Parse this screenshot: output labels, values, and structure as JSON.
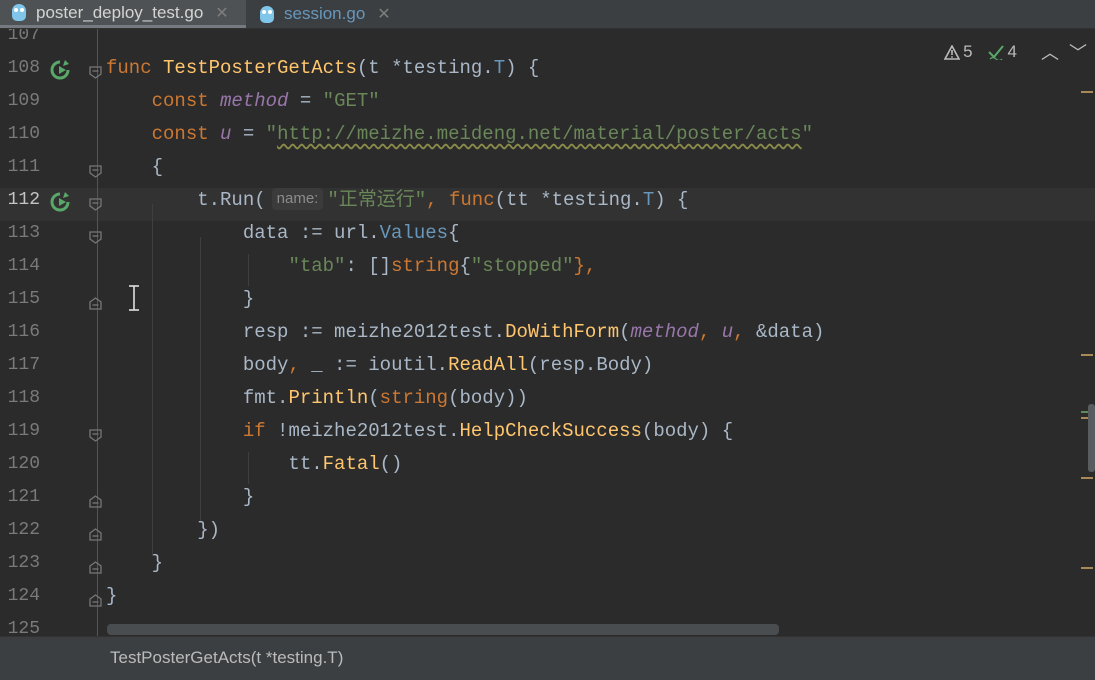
{
  "tabs": [
    {
      "label": "poster_deploy_test.go",
      "active": true
    },
    {
      "label": "session.go",
      "active": false
    }
  ],
  "inspections": {
    "warnings": "5",
    "ok": "4"
  },
  "hint_label": "name:",
  "breadcrumb": "TestPosterGetActs(t *testing.T)",
  "lines": [
    {
      "n": "107",
      "tokens": []
    },
    {
      "n": "108",
      "tokens": [
        {
          "t": "func ",
          "c": "kw"
        },
        {
          "t": "TestPosterGetActs",
          "c": "fn"
        },
        {
          "t": "(t ",
          "c": ""
        },
        {
          "t": "*testing.",
          "c": ""
        },
        {
          "t": "T",
          "c": "ty"
        },
        {
          "t": ") {",
          "c": ""
        }
      ]
    },
    {
      "n": "109",
      "tokens": [
        {
          "t": "    const ",
          "c": "kw"
        },
        {
          "t": "method",
          "c": "par"
        },
        {
          "t": " = ",
          "c": ""
        },
        {
          "t": "\"GET\"",
          "c": "str"
        }
      ]
    },
    {
      "n": "110",
      "tokens": [
        {
          "t": "    const ",
          "c": "kw"
        },
        {
          "t": "u",
          "c": "par"
        },
        {
          "t": " = ",
          "c": ""
        },
        {
          "t": "\"",
          "c": "str"
        },
        {
          "t": "http://meizhe.meideng.net/material/poster/acts",
          "c": "url"
        },
        {
          "t": "\"",
          "c": "str"
        }
      ]
    },
    {
      "n": "111",
      "tokens": [
        {
          "t": "    {",
          "c": ""
        }
      ]
    },
    {
      "n": "112",
      "tokens": [
        {
          "t": "        t.",
          "c": ""
        },
        {
          "t": "Run",
          "c": ""
        },
        {
          "t": "(",
          "c": ""
        },
        {
          "t": "",
          "c": "hint"
        },
        {
          "t": "\"正常运行\"",
          "c": "str"
        },
        {
          "t": ", ",
          "c": "kw"
        },
        {
          "t": "func",
          "c": "kw"
        },
        {
          "t": "(tt ",
          "c": ""
        },
        {
          "t": "*testing.",
          "c": ""
        },
        {
          "t": "T",
          "c": "ty"
        },
        {
          "t": ") {",
          "c": ""
        }
      ]
    },
    {
      "n": "113",
      "tokens": [
        {
          "t": "            data := url.",
          "c": ""
        },
        {
          "t": "Values",
          "c": "ty"
        },
        {
          "t": "{",
          "c": ""
        }
      ]
    },
    {
      "n": "114",
      "tokens": [
        {
          "t": "                ",
          "c": ""
        },
        {
          "t": "\"tab\"",
          "c": "str"
        },
        {
          "t": ": []",
          "c": ""
        },
        {
          "t": "string",
          "c": "kw"
        },
        {
          "t": "{",
          "c": ""
        },
        {
          "t": "\"stopped\"",
          "c": "str"
        },
        {
          "t": "},",
          "c": "kw"
        }
      ]
    },
    {
      "n": "115",
      "tokens": [
        {
          "t": "            }",
          "c": ""
        }
      ]
    },
    {
      "n": "116",
      "tokens": [
        {
          "t": "            resp := meizhe2012test.",
          "c": ""
        },
        {
          "t": "DoWithForm",
          "c": "fn"
        },
        {
          "t": "(",
          "c": ""
        },
        {
          "t": "method",
          "c": "par"
        },
        {
          "t": ", ",
          "c": "kw"
        },
        {
          "t": "u",
          "c": "par"
        },
        {
          "t": ", ",
          "c": "kw"
        },
        {
          "t": "&data)",
          "c": ""
        }
      ]
    },
    {
      "n": "117",
      "tokens": [
        {
          "t": "            body",
          "c": ""
        },
        {
          "t": ", ",
          "c": "kw"
        },
        {
          "t": "_ := ioutil.",
          "c": ""
        },
        {
          "t": "ReadAll",
          "c": "fn"
        },
        {
          "t": "(resp.Body)",
          "c": ""
        }
      ]
    },
    {
      "n": "118",
      "tokens": [
        {
          "t": "            fmt.",
          "c": ""
        },
        {
          "t": "Println",
          "c": "fn"
        },
        {
          "t": "(",
          "c": ""
        },
        {
          "t": "string",
          "c": "kw"
        },
        {
          "t": "(body))",
          "c": ""
        }
      ]
    },
    {
      "n": "119",
      "tokens": [
        {
          "t": "            ",
          "c": ""
        },
        {
          "t": "if ",
          "c": "kw"
        },
        {
          "t": "!meizhe2012test.",
          "c": ""
        },
        {
          "t": "HelpCheckSuccess",
          "c": "fn"
        },
        {
          "t": "(body) {",
          "c": ""
        }
      ]
    },
    {
      "n": "120",
      "tokens": [
        {
          "t": "                tt.",
          "c": ""
        },
        {
          "t": "Fatal",
          "c": "fn"
        },
        {
          "t": "()",
          "c": ""
        }
      ]
    },
    {
      "n": "121",
      "tokens": [
        {
          "t": "            }",
          "c": ""
        }
      ]
    },
    {
      "n": "122",
      "tokens": [
        {
          "t": "        })",
          "c": ""
        }
      ]
    },
    {
      "n": "123",
      "tokens": [
        {
          "t": "    }",
          "c": ""
        }
      ]
    },
    {
      "n": "124",
      "tokens": [
        {
          "t": "}",
          "c": ""
        }
      ]
    },
    {
      "n": "125",
      "tokens": []
    }
  ],
  "colors": {
    "background": "#2b2b2b",
    "keyword": "#cc7832",
    "function": "#ffc66d",
    "string": "#6a8759",
    "param": "#9876aa",
    "type": "#6897bb"
  }
}
